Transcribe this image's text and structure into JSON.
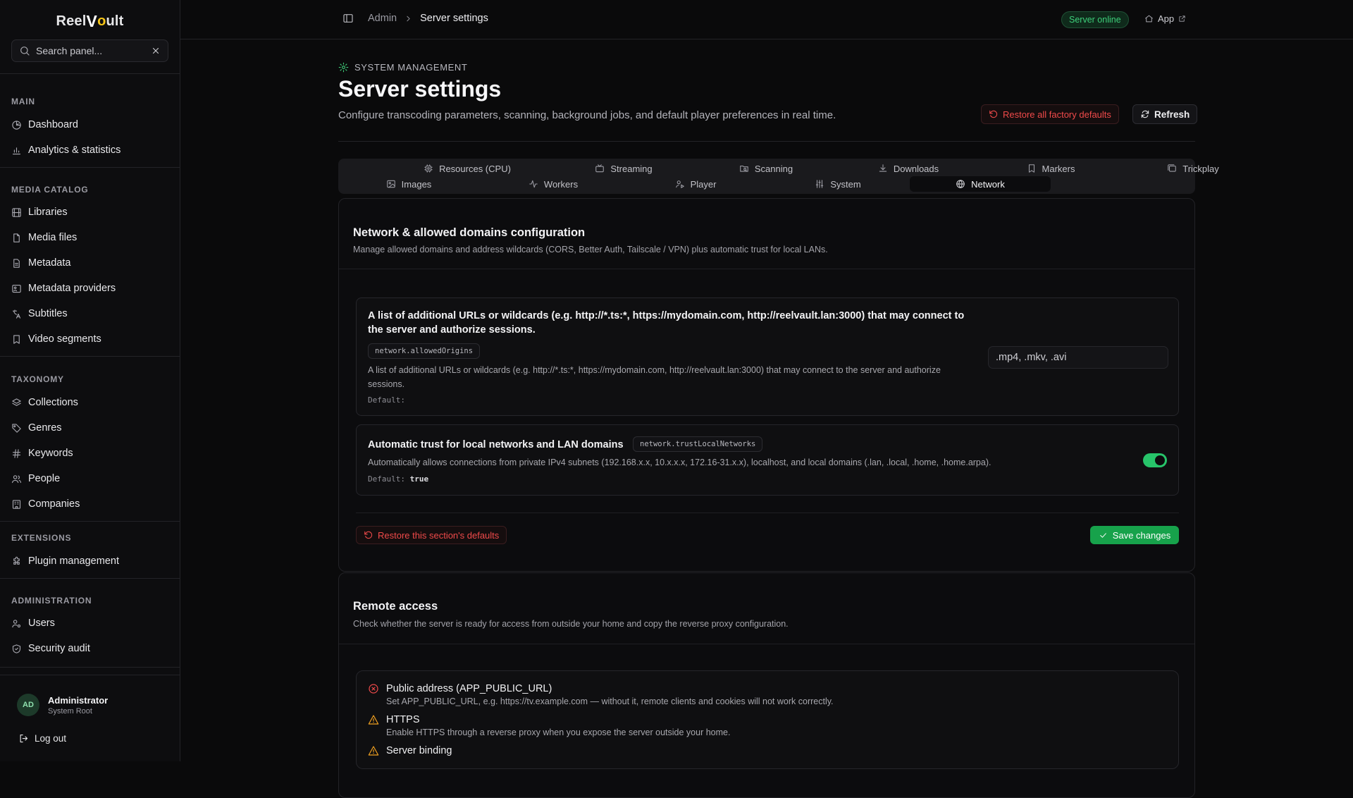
{
  "brand": {
    "part1": "Reel",
    "part2": "V",
    "part3": "o",
    "part4": "ult"
  },
  "sidebar": {
    "search_placeholder": "Search panel...",
    "sections": [
      {
        "heading": "MAIN",
        "items": [
          {
            "label": "Dashboard",
            "icon": "gauge-icon"
          },
          {
            "label": "Analytics & statistics",
            "icon": "bar-chart-icon"
          }
        ]
      },
      {
        "heading": "MEDIA CATALOG",
        "items": [
          {
            "label": "Libraries",
            "icon": "film-icon"
          },
          {
            "label": "Media files",
            "icon": "file-icon"
          },
          {
            "label": "Metadata",
            "icon": "document-icon"
          },
          {
            "label": "Metadata providers",
            "icon": "database-icon"
          },
          {
            "label": "Subtitles",
            "icon": "language-icon"
          },
          {
            "label": "Video segments",
            "icon": "bookmark-icon"
          }
        ]
      },
      {
        "heading": "TAXONOMY",
        "items": [
          {
            "label": "Collections",
            "icon": "layers-icon"
          },
          {
            "label": "Genres",
            "icon": "tag-icon"
          },
          {
            "label": "Keywords",
            "icon": "hash-icon"
          },
          {
            "label": "People",
            "icon": "users-icon"
          },
          {
            "label": "Companies",
            "icon": "building-icon"
          }
        ]
      },
      {
        "heading": "EXTENSIONS",
        "items": [
          {
            "label": "Plugin management",
            "icon": "puzzle-icon"
          }
        ]
      },
      {
        "heading": "ADMINISTRATION",
        "items": [
          {
            "label": "Users",
            "icon": "user-cog-icon"
          },
          {
            "label": "Security audit",
            "icon": "shield-icon"
          }
        ]
      }
    ],
    "user": {
      "initials": "AD",
      "name": "Administrator",
      "role": "System Root"
    },
    "logout_label": "Log out"
  },
  "topbar": {
    "crumb_root": "Admin",
    "crumb_current": "Server settings",
    "status": "Server online",
    "app_link": "App"
  },
  "page": {
    "eyebrow": "SYSTEM MANAGEMENT",
    "title": "Server settings",
    "subtitle": "Configure transcoding parameters, scanning, background jobs, and default player preferences in real time.",
    "restore_all": "Restore all factory defaults",
    "refresh": "Refresh"
  },
  "tabs": [
    {
      "label": "Resources (CPU)",
      "icon": "cpu-icon"
    },
    {
      "label": "Streaming",
      "icon": "tv-icon"
    },
    {
      "label": "Scanning",
      "icon": "folder-search-icon"
    },
    {
      "label": "Downloads",
      "icon": "download-icon"
    },
    {
      "label": "Markers",
      "icon": "bookmark-icon"
    },
    {
      "label": "Trickplay",
      "icon": "images-icon"
    },
    {
      "label": "Images",
      "icon": "image-icon"
    },
    {
      "label": "Workers",
      "icon": "activity-icon"
    },
    {
      "label": "Player",
      "icon": "user-play-icon"
    },
    {
      "label": "System",
      "icon": "sliders-icon"
    },
    {
      "label": "Network",
      "icon": "globe-icon"
    }
  ],
  "network": {
    "title": "Network & allowed domains configuration",
    "desc": "Manage allowed domains and address wildcards (CORS, Better Auth, Tailscale / VPN) plus automatic trust for local LANs.",
    "origins": {
      "title": "A list of additional URLs or wildcards (e.g. http://*.ts:*, https://mydomain.com, http://reelvault.lan:3000) that may connect to the server and authorize sessions.",
      "key": "network.allowedOrigins",
      "desc": "A list of additional URLs or wildcards (e.g. http://*.ts:*, https://mydomain.com, http://reelvault.lan:3000) that may connect to the server and authorize sessions.",
      "default_label": "Default:",
      "default_value": "",
      "input_value": ".mp4, .mkv, .avi"
    },
    "trust": {
      "title": "Automatic trust for local networks and LAN domains",
      "key": "network.trustLocalNetworks",
      "desc": "Automatically allows connections from private IPv4 subnets (192.168.x.x, 10.x.x.x, 172.16-31.x.x), localhost, and local domains (.lan, .local, .home, .home.arpa).",
      "default_label": "Default:",
      "default_value": "true",
      "enabled": true
    },
    "restore_section": "Restore this section's defaults",
    "save": "Save changes"
  },
  "remote": {
    "title": "Remote access",
    "desc": "Check whether the server is ready for access from outside your home and copy the reverse proxy configuration.",
    "checks": [
      {
        "status": "error",
        "icon": "x-circle-icon",
        "title": "Public address (APP_PUBLIC_URL)",
        "desc": "Set APP_PUBLIC_URL, e.g. https://tv.example.com — without it, remote clients and cookies will not work correctly."
      },
      {
        "status": "warning",
        "icon": "warning-triangle-icon",
        "title": "HTTPS",
        "desc": "Enable HTTPS through a reverse proxy when you expose the server outside your home."
      },
      {
        "status": "warning",
        "icon": "warning-triangle-icon",
        "title": "Server binding",
        "desc": ""
      }
    ]
  },
  "colors": {
    "accent_green": "#17a24b",
    "online_green": "#3ecf7a",
    "danger_red": "#f04a4a",
    "warning_amber": "#f0a020"
  }
}
